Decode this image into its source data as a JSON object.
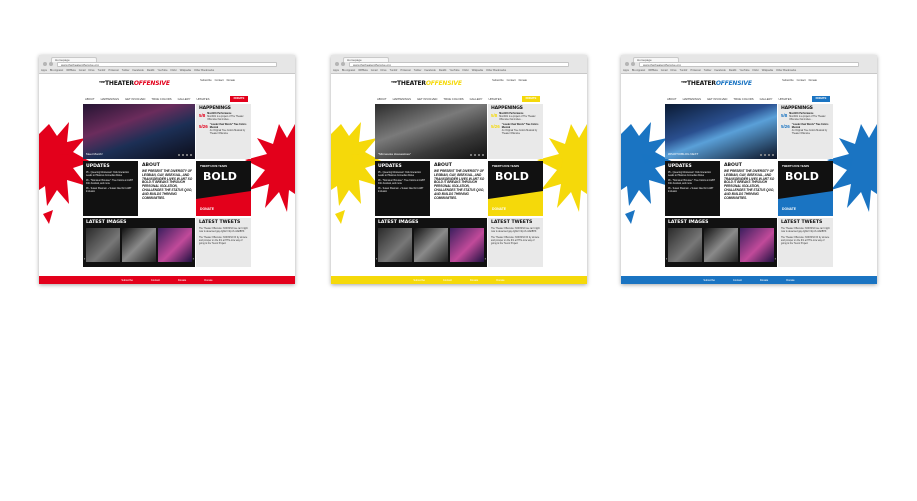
{
  "browser": {
    "tab_title": "Homepage",
    "url": "www.thetheateroffensive.org",
    "bookmarks": [
      "Apps",
      "Blu Apparel",
      "WPBeta",
      "Gmail",
      "Drive",
      "Tumblr",
      "Pinterest",
      "Twitter",
      "Facebook",
      "Reddit",
      "YouTube",
      "Flickr",
      "Wikipedia",
      "Other Bookmarks"
    ]
  },
  "site": {
    "logo_theater": "THEATER",
    "logo_offensive": "OFFENSIVE",
    "logo_prefix": "THE",
    "top_links": [
      "Subscribe",
      "Contact",
      "Donate"
    ],
    "nav": [
      "About",
      "Happenings",
      "Get Involved",
      "True Colors",
      "Gallery",
      "Updates"
    ],
    "donate_button": "DONATE",
    "happenings_title": "HAPPENINGS",
    "events": [
      {
        "date": "5/8",
        "title": "Month01 Performance",
        "desc": "Month01 is a project of The Theater Offensive that invites..."
      },
      {
        "date": "5/26",
        "title": "\"Louder than Words\" True Colors Musical",
        "desc": "An Original True Colors Musical by Theater Offensive"
      }
    ],
    "updates_title": "UPDATES",
    "updates": [
      "05 - Queering Montessori: Kids Interaction Leads to Hilarious Comedian Roles",
      "06 - \"Monsieur Brousse\": True Colors at LGBT Film Festival, and more",
      "06 - Susan Shannon + Susan Noel for LGBT Inclusion"
    ],
    "about_title": "ABOUT",
    "about_text": "We present the diversity of lesbian, gay, bisexual, and transgender lives in art so bold it breaks through personal isolation, challenges the status quo, and builds thriving communities.",
    "bold_tagline": "TWENTY-FIVE YEARS",
    "bold_word": "BOLD",
    "bold_donate": "DONATE",
    "latest_images_title": "LATEST IMAGES",
    "latest_tweets_title": "LATEST TWEETS",
    "tweets": [
      "The Theater Offensive: NOKISSO we can't right now is deserved gay-rights! http://t.co/ElBHK",
      "The Theater Offensive: NOKISSO IF by sincere and prosper on the 9/1 at HTG-nice way of going to the Trevor Project"
    ],
    "footer_links": [
      "Subscribe",
      "Contact",
      "Donate",
      "Donate"
    ]
  },
  "variants": [
    {
      "name": "red",
      "accent": "#e3001b",
      "hero_caption": "Meet Month!"
    },
    {
      "name": "yellow",
      "accent": "#f5d90a",
      "hero_caption": "\"Minnesota Housewives\""
    },
    {
      "name": "blue",
      "accent": "#1a74c2",
      "hero_caption": "#PHOTO/BLOG NEXT"
    }
  ]
}
